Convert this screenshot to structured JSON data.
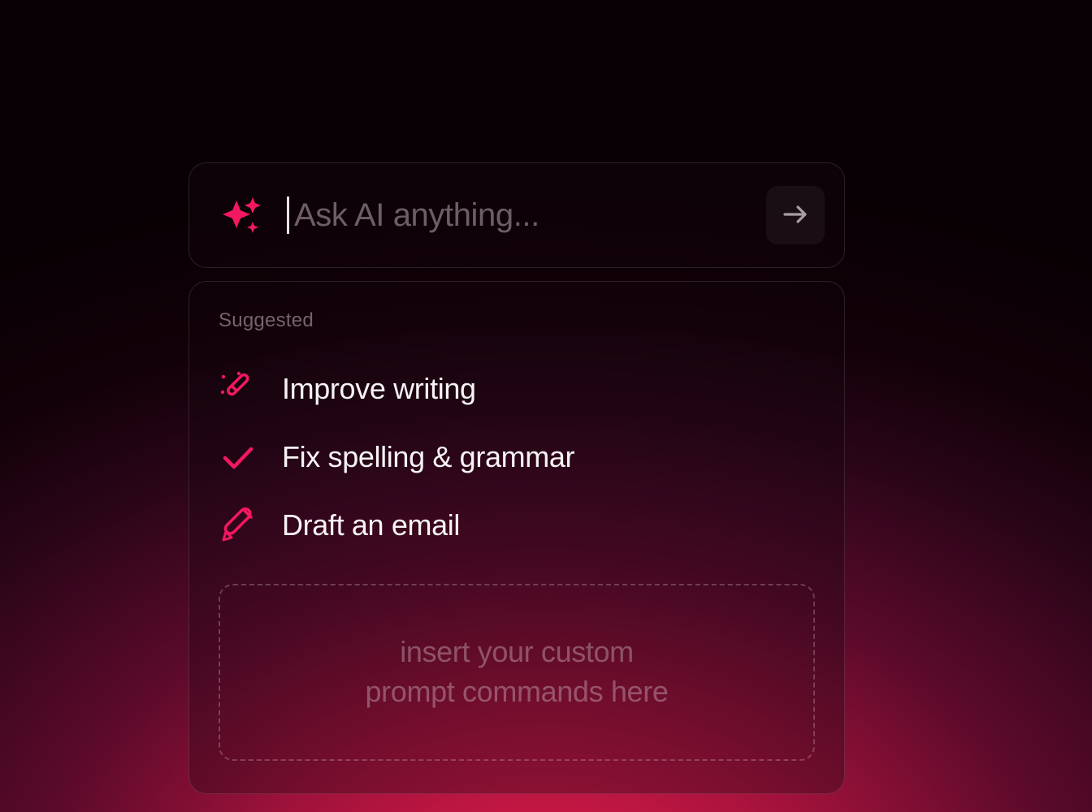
{
  "colors": {
    "accent": "#f31860",
    "text_primary": "#f7f3f5",
    "text_muted": "rgba(200,180,190,0.55)"
  },
  "prompt": {
    "placeholder": "Ask AI anything...",
    "value": ""
  },
  "suggestions": {
    "heading": "Suggested",
    "items": [
      {
        "icon": "magic-wand-icon",
        "label": "Improve writing"
      },
      {
        "icon": "check-icon",
        "label": "Fix spelling & grammar"
      },
      {
        "icon": "pencil-icon",
        "label": "Draft an email"
      }
    ]
  },
  "custom_dropzone": {
    "line1": "insert your custom",
    "line2": "prompt commands here"
  }
}
